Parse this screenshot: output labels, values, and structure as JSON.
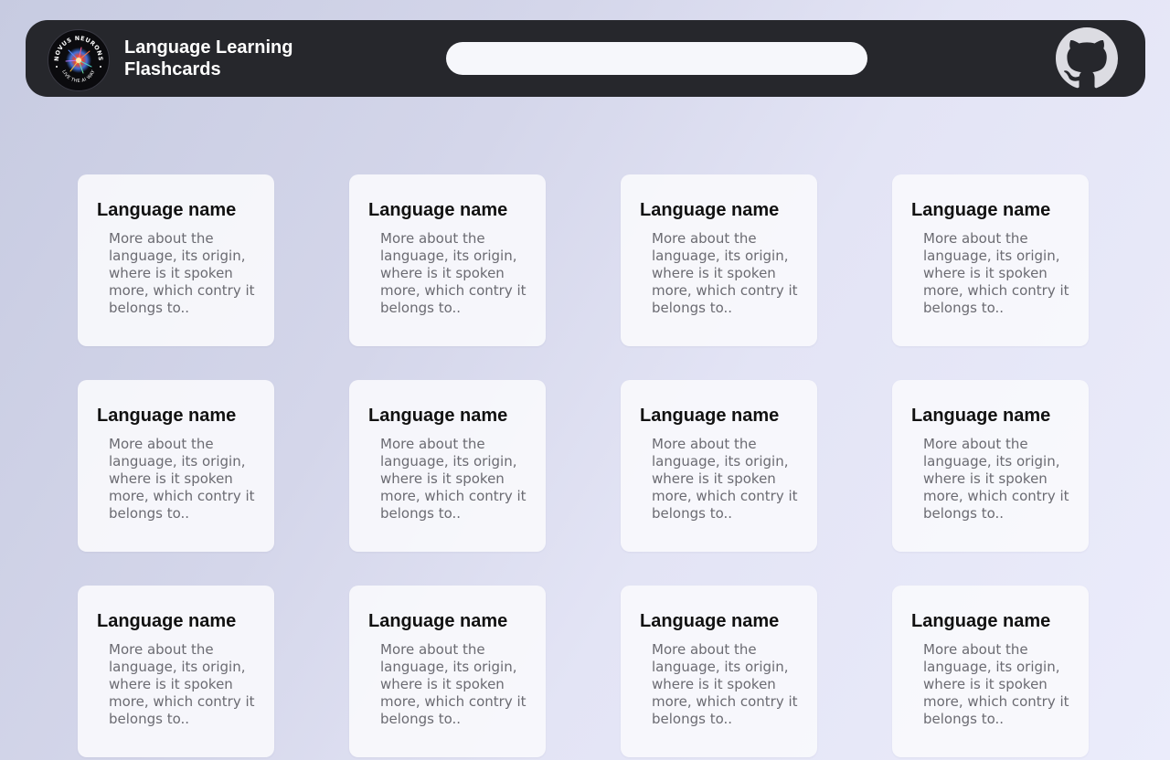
{
  "header": {
    "logo_text_top": "NOVUS NEURONS",
    "logo_text_bottom": "LIVE THE AI WAY",
    "title": "Language Learning Flashcards",
    "search": {
      "value": "",
      "placeholder": ""
    },
    "github_icon": "github-icon"
  },
  "cards": [
    {
      "title": "Language name",
      "description": "More about the language, its origin, where is it spoken more, which contry it belongs to.."
    },
    {
      "title": "Language name",
      "description": "More about the language, its origin, where is it spoken more, which contry it belongs to.."
    },
    {
      "title": "Language name",
      "description": "More about the language, its origin, where is it spoken more, which contry it belongs to.."
    },
    {
      "title": "Language name",
      "description": "More about the language, its origin, where is it spoken more, which contry it belongs to.."
    },
    {
      "title": "Language name",
      "description": "More about the language, its origin, where is it spoken more, which contry it belongs to.."
    },
    {
      "title": "Language name",
      "description": "More about the language, its origin, where is it spoken more, which contry it belongs to.."
    },
    {
      "title": "Language name",
      "description": "More about the language, its origin, where is it spoken more, which contry it belongs to.."
    },
    {
      "title": "Language name",
      "description": "More about the language, its origin, where is it spoken more, which contry it belongs to.."
    },
    {
      "title": "Language name",
      "description": "More about the language, its origin, where is it spoken more, which contry it belongs to.."
    },
    {
      "title": "Language name",
      "description": "More about the language, its origin, where is it spoken more, which contry it belongs to.."
    },
    {
      "title": "Language name",
      "description": "More about the language, its origin, where is it spoken more, which contry it belongs to.."
    },
    {
      "title": "Language name",
      "description": "More about the language, its origin, where is it spoken more, which contry it belongs to.."
    }
  ],
  "colors": {
    "navbar": "#26272c",
    "card": "#f8f8fc",
    "title_text": "#111111",
    "body_text": "#6b6b72",
    "github_icon": "#dcdce2"
  }
}
